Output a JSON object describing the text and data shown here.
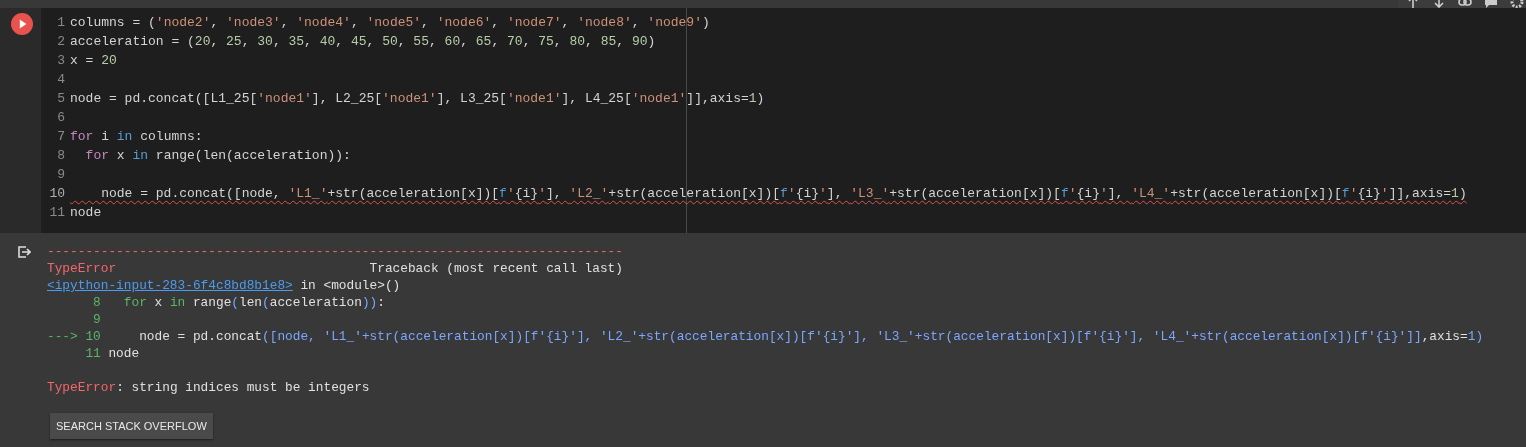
{
  "cell": {
    "code_lines": [
      {
        "number": "1",
        "tokens": [
          {
            "kind": "plain",
            "text": "columns = ("
          },
          {
            "kind": "string",
            "text": "'node2'"
          },
          {
            "kind": "plain",
            "text": ", "
          },
          {
            "kind": "string",
            "text": "'node3'"
          },
          {
            "kind": "plain",
            "text": ", "
          },
          {
            "kind": "string",
            "text": "'node4'"
          },
          {
            "kind": "plain",
            "text": ", "
          },
          {
            "kind": "string",
            "text": "'node5'"
          },
          {
            "kind": "plain",
            "text": ", "
          },
          {
            "kind": "string",
            "text": "'node6'"
          },
          {
            "kind": "plain",
            "text": ", "
          },
          {
            "kind": "string",
            "text": "'node7'"
          },
          {
            "kind": "plain",
            "text": ", "
          },
          {
            "kind": "string",
            "text": "'node8'"
          },
          {
            "kind": "plain",
            "text": ", "
          },
          {
            "kind": "string",
            "text": "'node9'"
          },
          {
            "kind": "plain",
            "text": ")"
          }
        ],
        "error": false
      },
      {
        "number": "2",
        "tokens": [
          {
            "kind": "plain",
            "text": "acceleration = ("
          },
          {
            "kind": "number",
            "text": "20"
          },
          {
            "kind": "plain",
            "text": ", "
          },
          {
            "kind": "number",
            "text": "25"
          },
          {
            "kind": "plain",
            "text": ", "
          },
          {
            "kind": "number",
            "text": "30"
          },
          {
            "kind": "plain",
            "text": ", "
          },
          {
            "kind": "number",
            "text": "35"
          },
          {
            "kind": "plain",
            "text": ", "
          },
          {
            "kind": "number",
            "text": "40"
          },
          {
            "kind": "plain",
            "text": ", "
          },
          {
            "kind": "number",
            "text": "45"
          },
          {
            "kind": "plain",
            "text": ", "
          },
          {
            "kind": "number",
            "text": "50"
          },
          {
            "kind": "plain",
            "text": ", "
          },
          {
            "kind": "number",
            "text": "55"
          },
          {
            "kind": "plain",
            "text": ", "
          },
          {
            "kind": "number",
            "text": "60"
          },
          {
            "kind": "plain",
            "text": ", "
          },
          {
            "kind": "number",
            "text": "65"
          },
          {
            "kind": "plain",
            "text": ", "
          },
          {
            "kind": "number",
            "text": "70"
          },
          {
            "kind": "plain",
            "text": ", "
          },
          {
            "kind": "number",
            "text": "75"
          },
          {
            "kind": "plain",
            "text": ", "
          },
          {
            "kind": "number",
            "text": "80"
          },
          {
            "kind": "plain",
            "text": ", "
          },
          {
            "kind": "number",
            "text": "85"
          },
          {
            "kind": "plain",
            "text": ", "
          },
          {
            "kind": "number",
            "text": "90"
          },
          {
            "kind": "plain",
            "text": ")"
          }
        ],
        "error": false
      },
      {
        "number": "3",
        "tokens": [
          {
            "kind": "plain",
            "text": "x = "
          },
          {
            "kind": "number",
            "text": "20"
          }
        ],
        "error": false
      },
      {
        "number": "4",
        "error": false
      },
      {
        "number": "5",
        "tokens": [
          {
            "kind": "plain",
            "text": "node = pd.concat([L1_25["
          },
          {
            "kind": "string",
            "text": "'node1'"
          },
          {
            "kind": "plain",
            "text": "], L2_25["
          },
          {
            "kind": "string",
            "text": "'node1'"
          },
          {
            "kind": "plain",
            "text": "], L3_25["
          },
          {
            "kind": "string",
            "text": "'node1'"
          },
          {
            "kind": "plain",
            "text": "], L4_25["
          },
          {
            "kind": "string",
            "text": "'node1'"
          },
          {
            "kind": "plain",
            "text": "]],axis="
          },
          {
            "kind": "number",
            "text": "1"
          },
          {
            "kind": "plain",
            "text": ")"
          }
        ],
        "error": false
      },
      {
        "number": "6",
        "error": false
      },
      {
        "number": "7",
        "tokens": [
          {
            "kind": "control",
            "text": "for"
          },
          {
            "kind": "plain",
            "text": " i "
          },
          {
            "kind": "keyword",
            "text": "in"
          },
          {
            "kind": "plain",
            "text": " columns:"
          }
        ],
        "error": false
      },
      {
        "number": "8",
        "tokens": [
          {
            "kind": "control",
            "text": "  for"
          },
          {
            "kind": "plain",
            "text": " x "
          },
          {
            "kind": "keyword",
            "text": "in"
          },
          {
            "kind": "plain",
            "text": " range(len(acceleration)):"
          }
        ],
        "error": false
      },
      {
        "number": "9",
        "error": false
      },
      {
        "number": "10",
        "tokens": [
          {
            "kind": "plain",
            "text": "    node = pd.concat([node, "
          },
          {
            "kind": "string",
            "text": "'L1_'"
          },
          {
            "kind": "plain",
            "text": "+str(acceleration[x])["
          },
          {
            "kind": "fprefix",
            "text": "f"
          },
          {
            "kind": "string",
            "text": "'"
          },
          {
            "kind": "plain",
            "text": "{i}"
          },
          {
            "kind": "string",
            "text": "'"
          },
          {
            "kind": "plain",
            "text": "], "
          },
          {
            "kind": "string",
            "text": "'L2_'"
          },
          {
            "kind": "plain",
            "text": "+str(acceleration[x])["
          },
          {
            "kind": "fprefix",
            "text": "f"
          },
          {
            "kind": "string",
            "text": "'"
          },
          {
            "kind": "plain",
            "text": "{i}"
          },
          {
            "kind": "string",
            "text": "'"
          },
          {
            "kind": "plain",
            "text": "], "
          },
          {
            "kind": "string",
            "text": "'L3_'"
          },
          {
            "kind": "plain",
            "text": "+str(acceleration[x])["
          },
          {
            "kind": "fprefix",
            "text": "f"
          },
          {
            "kind": "string",
            "text": "'"
          },
          {
            "kind": "plain",
            "text": "{i}"
          },
          {
            "kind": "string",
            "text": "'"
          },
          {
            "kind": "plain",
            "text": "], "
          },
          {
            "kind": "string",
            "text": "'L4_'"
          },
          {
            "kind": "plain",
            "text": "+str(acceleration[x])["
          },
          {
            "kind": "fprefix",
            "text": "f"
          },
          {
            "kind": "string",
            "text": "'"
          },
          {
            "kind": "plain",
            "text": "{i}"
          },
          {
            "kind": "string",
            "text": "'"
          },
          {
            "kind": "plain",
            "text": "]],axis="
          },
          {
            "kind": "number",
            "text": "1"
          },
          {
            "kind": "plain",
            "text": ")"
          }
        ],
        "error": true
      },
      {
        "number": "11",
        "tokens": [
          {
            "kind": "plain",
            "text": "node"
          }
        ],
        "error": false
      }
    ]
  },
  "output": {
    "lines": [
      {
        "tokens": [
          {
            "kind": "error",
            "text": "---------------------------------------------------------------------------"
          }
        ]
      },
      {
        "tokens": [
          {
            "kind": "error",
            "text": "TypeError"
          },
          {
            "kind": "plain",
            "text": "                                 Traceback (most recent call last)"
          }
        ]
      },
      {
        "tokens": [
          {
            "kind": "link",
            "text": "<ipython-input-283-6f4c8bd8b1e8>"
          },
          {
            "kind": "plain",
            "text": " in <module>()"
          }
        ]
      },
      {
        "tokens": [
          {
            "kind": "lineno",
            "text": "      8"
          },
          {
            "kind": "kw",
            "text": "   for"
          },
          {
            "kind": "plain",
            "text": " x "
          },
          {
            "kind": "kw",
            "text": "in"
          },
          {
            "kind": "plain",
            "text": " range"
          },
          {
            "kind": "call",
            "text": "("
          },
          {
            "kind": "plain",
            "text": "len"
          },
          {
            "kind": "call",
            "text": "("
          },
          {
            "kind": "plain",
            "text": "acceleration"
          },
          {
            "kind": "call",
            "text": "))"
          },
          {
            "kind": "plain",
            "text": ":"
          }
        ]
      },
      {
        "tokens": [
          {
            "kind": "lineno",
            "text": "      9"
          }
        ]
      },
      {
        "tokens": [
          {
            "kind": "lineno",
            "text": "---> 10"
          },
          {
            "kind": "plain",
            "text": "     node = pd.concat"
          },
          {
            "kind": "call",
            "text": "([node, 'L1_'+str(acceleration[x])[f'{i}'], 'L2_'+str(acceleration[x])[f'{i}'], 'L3_'+str(acceleration[x])[f'{i}'], 'L4_'+str(acceleration[x])[f'{i}']]"
          },
          {
            "kind": "plain",
            "text": ",axis="
          },
          {
            "kind": "call",
            "text": "1)"
          }
        ]
      },
      {
        "tokens": [
          {
            "kind": "lineno",
            "text": "     11"
          },
          {
            "kind": "plain",
            "text": " node"
          }
        ]
      }
    ],
    "error_message": {
      "tokens": [
        {
          "kind": "error",
          "text": "TypeError"
        },
        {
          "kind": "plain",
          "text": ": string indices must be integers"
        }
      ]
    },
    "button": "SEARCH STACK OVERFLOW"
  }
}
